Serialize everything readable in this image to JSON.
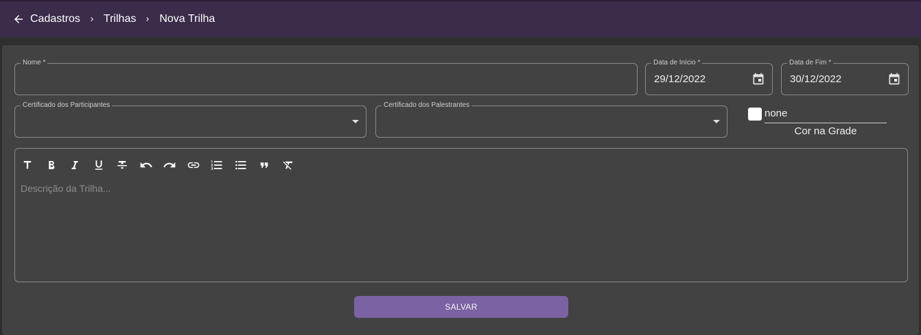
{
  "breadcrumb": {
    "items": [
      "Cadastros",
      "Trilhas",
      "Nova Trilha"
    ]
  },
  "form": {
    "nome": {
      "label": "Nome *",
      "value": ""
    },
    "data_inicio": {
      "label": "Data de Início *",
      "value": "29/12/2022"
    },
    "data_fim": {
      "label": "Data de Fim *",
      "value": "30/12/2022"
    },
    "cert_participantes": {
      "label": "Certificado dos Participantes",
      "value": ""
    },
    "cert_palestrantes": {
      "label": "Certificado dos Palestrantes",
      "value": ""
    },
    "cor": {
      "value": "none",
      "label": "Cor na Grade",
      "swatch": "#ffffff"
    }
  },
  "editor": {
    "placeholder": "Descrição da Trilha...",
    "toolbar": [
      "heading-icon",
      "bold-icon",
      "italic-icon",
      "underline-icon",
      "strikethrough-icon",
      "undo-icon",
      "redo-icon",
      "link-icon",
      "numbered-list-icon",
      "bullet-list-icon",
      "quote-icon",
      "clear-format-icon"
    ]
  },
  "actions": {
    "save_label": "SALVAR"
  },
  "colors": {
    "appbar": "#3a2c4a",
    "accent": "#7b62a3",
    "card": "#424242",
    "background": "#2f2f2f"
  }
}
